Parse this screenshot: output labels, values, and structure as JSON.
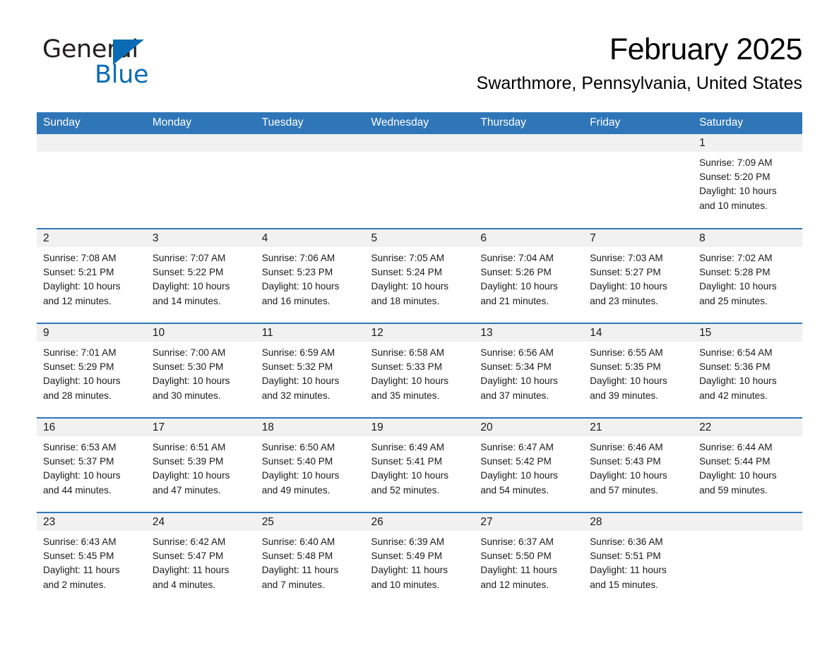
{
  "brand": {
    "name_part1": "General",
    "name_part2": "Blue",
    "triangle_icon": "triangle-logo-icon",
    "accent_color": "#0b6cb5"
  },
  "header": {
    "month_title": "February 2025",
    "location": "Swarthmore, Pennsylvania, United States"
  },
  "theme": {
    "header_bar_color": "#2f76b8",
    "daynum_band_color": "#f1f1f1",
    "row_divider_color": "#2f76b8",
    "text_color": "#1a1a1a"
  },
  "calendar": {
    "weekday_headers": [
      "Sunday",
      "Monday",
      "Tuesday",
      "Wednesday",
      "Thursday",
      "Friday",
      "Saturday"
    ],
    "weeks": [
      [
        {
          "blank": true
        },
        {
          "blank": true
        },
        {
          "blank": true
        },
        {
          "blank": true
        },
        {
          "blank": true
        },
        {
          "blank": true
        },
        {
          "day": "1",
          "sunrise": "Sunrise: 7:09 AM",
          "sunset": "Sunset: 5:20 PM",
          "daylight1": "Daylight: 10 hours",
          "daylight2": "and 10 minutes."
        }
      ],
      [
        {
          "day": "2",
          "sunrise": "Sunrise: 7:08 AM",
          "sunset": "Sunset: 5:21 PM",
          "daylight1": "Daylight: 10 hours",
          "daylight2": "and 12 minutes."
        },
        {
          "day": "3",
          "sunrise": "Sunrise: 7:07 AM",
          "sunset": "Sunset: 5:22 PM",
          "daylight1": "Daylight: 10 hours",
          "daylight2": "and 14 minutes."
        },
        {
          "day": "4",
          "sunrise": "Sunrise: 7:06 AM",
          "sunset": "Sunset: 5:23 PM",
          "daylight1": "Daylight: 10 hours",
          "daylight2": "and 16 minutes."
        },
        {
          "day": "5",
          "sunrise": "Sunrise: 7:05 AM",
          "sunset": "Sunset: 5:24 PM",
          "daylight1": "Daylight: 10 hours",
          "daylight2": "and 18 minutes."
        },
        {
          "day": "6",
          "sunrise": "Sunrise: 7:04 AM",
          "sunset": "Sunset: 5:26 PM",
          "daylight1": "Daylight: 10 hours",
          "daylight2": "and 21 minutes."
        },
        {
          "day": "7",
          "sunrise": "Sunrise: 7:03 AM",
          "sunset": "Sunset: 5:27 PM",
          "daylight1": "Daylight: 10 hours",
          "daylight2": "and 23 minutes."
        },
        {
          "day": "8",
          "sunrise": "Sunrise: 7:02 AM",
          "sunset": "Sunset: 5:28 PM",
          "daylight1": "Daylight: 10 hours",
          "daylight2": "and 25 minutes."
        }
      ],
      [
        {
          "day": "9",
          "sunrise": "Sunrise: 7:01 AM",
          "sunset": "Sunset: 5:29 PM",
          "daylight1": "Daylight: 10 hours",
          "daylight2": "and 28 minutes."
        },
        {
          "day": "10",
          "sunrise": "Sunrise: 7:00 AM",
          "sunset": "Sunset: 5:30 PM",
          "daylight1": "Daylight: 10 hours",
          "daylight2": "and 30 minutes."
        },
        {
          "day": "11",
          "sunrise": "Sunrise: 6:59 AM",
          "sunset": "Sunset: 5:32 PM",
          "daylight1": "Daylight: 10 hours",
          "daylight2": "and 32 minutes."
        },
        {
          "day": "12",
          "sunrise": "Sunrise: 6:58 AM",
          "sunset": "Sunset: 5:33 PM",
          "daylight1": "Daylight: 10 hours",
          "daylight2": "and 35 minutes."
        },
        {
          "day": "13",
          "sunrise": "Sunrise: 6:56 AM",
          "sunset": "Sunset: 5:34 PM",
          "daylight1": "Daylight: 10 hours",
          "daylight2": "and 37 minutes."
        },
        {
          "day": "14",
          "sunrise": "Sunrise: 6:55 AM",
          "sunset": "Sunset: 5:35 PM",
          "daylight1": "Daylight: 10 hours",
          "daylight2": "and 39 minutes."
        },
        {
          "day": "15",
          "sunrise": "Sunrise: 6:54 AM",
          "sunset": "Sunset: 5:36 PM",
          "daylight1": "Daylight: 10 hours",
          "daylight2": "and 42 minutes."
        }
      ],
      [
        {
          "day": "16",
          "sunrise": "Sunrise: 6:53 AM",
          "sunset": "Sunset: 5:37 PM",
          "daylight1": "Daylight: 10 hours",
          "daylight2": "and 44 minutes."
        },
        {
          "day": "17",
          "sunrise": "Sunrise: 6:51 AM",
          "sunset": "Sunset: 5:39 PM",
          "daylight1": "Daylight: 10 hours",
          "daylight2": "and 47 minutes."
        },
        {
          "day": "18",
          "sunrise": "Sunrise: 6:50 AM",
          "sunset": "Sunset: 5:40 PM",
          "daylight1": "Daylight: 10 hours",
          "daylight2": "and 49 minutes."
        },
        {
          "day": "19",
          "sunrise": "Sunrise: 6:49 AM",
          "sunset": "Sunset: 5:41 PM",
          "daylight1": "Daylight: 10 hours",
          "daylight2": "and 52 minutes."
        },
        {
          "day": "20",
          "sunrise": "Sunrise: 6:47 AM",
          "sunset": "Sunset: 5:42 PM",
          "daylight1": "Daylight: 10 hours",
          "daylight2": "and 54 minutes."
        },
        {
          "day": "21",
          "sunrise": "Sunrise: 6:46 AM",
          "sunset": "Sunset: 5:43 PM",
          "daylight1": "Daylight: 10 hours",
          "daylight2": "and 57 minutes."
        },
        {
          "day": "22",
          "sunrise": "Sunrise: 6:44 AM",
          "sunset": "Sunset: 5:44 PM",
          "daylight1": "Daylight: 10 hours",
          "daylight2": "and 59 minutes."
        }
      ],
      [
        {
          "day": "23",
          "sunrise": "Sunrise: 6:43 AM",
          "sunset": "Sunset: 5:45 PM",
          "daylight1": "Daylight: 11 hours",
          "daylight2": "and 2 minutes."
        },
        {
          "day": "24",
          "sunrise": "Sunrise: 6:42 AM",
          "sunset": "Sunset: 5:47 PM",
          "daylight1": "Daylight: 11 hours",
          "daylight2": "and 4 minutes."
        },
        {
          "day": "25",
          "sunrise": "Sunrise: 6:40 AM",
          "sunset": "Sunset: 5:48 PM",
          "daylight1": "Daylight: 11 hours",
          "daylight2": "and 7 minutes."
        },
        {
          "day": "26",
          "sunrise": "Sunrise: 6:39 AM",
          "sunset": "Sunset: 5:49 PM",
          "daylight1": "Daylight: 11 hours",
          "daylight2": "and 10 minutes."
        },
        {
          "day": "27",
          "sunrise": "Sunrise: 6:37 AM",
          "sunset": "Sunset: 5:50 PM",
          "daylight1": "Daylight: 11 hours",
          "daylight2": "and 12 minutes."
        },
        {
          "day": "28",
          "sunrise": "Sunrise: 6:36 AM",
          "sunset": "Sunset: 5:51 PM",
          "daylight1": "Daylight: 11 hours",
          "daylight2": "and 15 minutes."
        },
        {
          "blank": true
        }
      ]
    ]
  }
}
